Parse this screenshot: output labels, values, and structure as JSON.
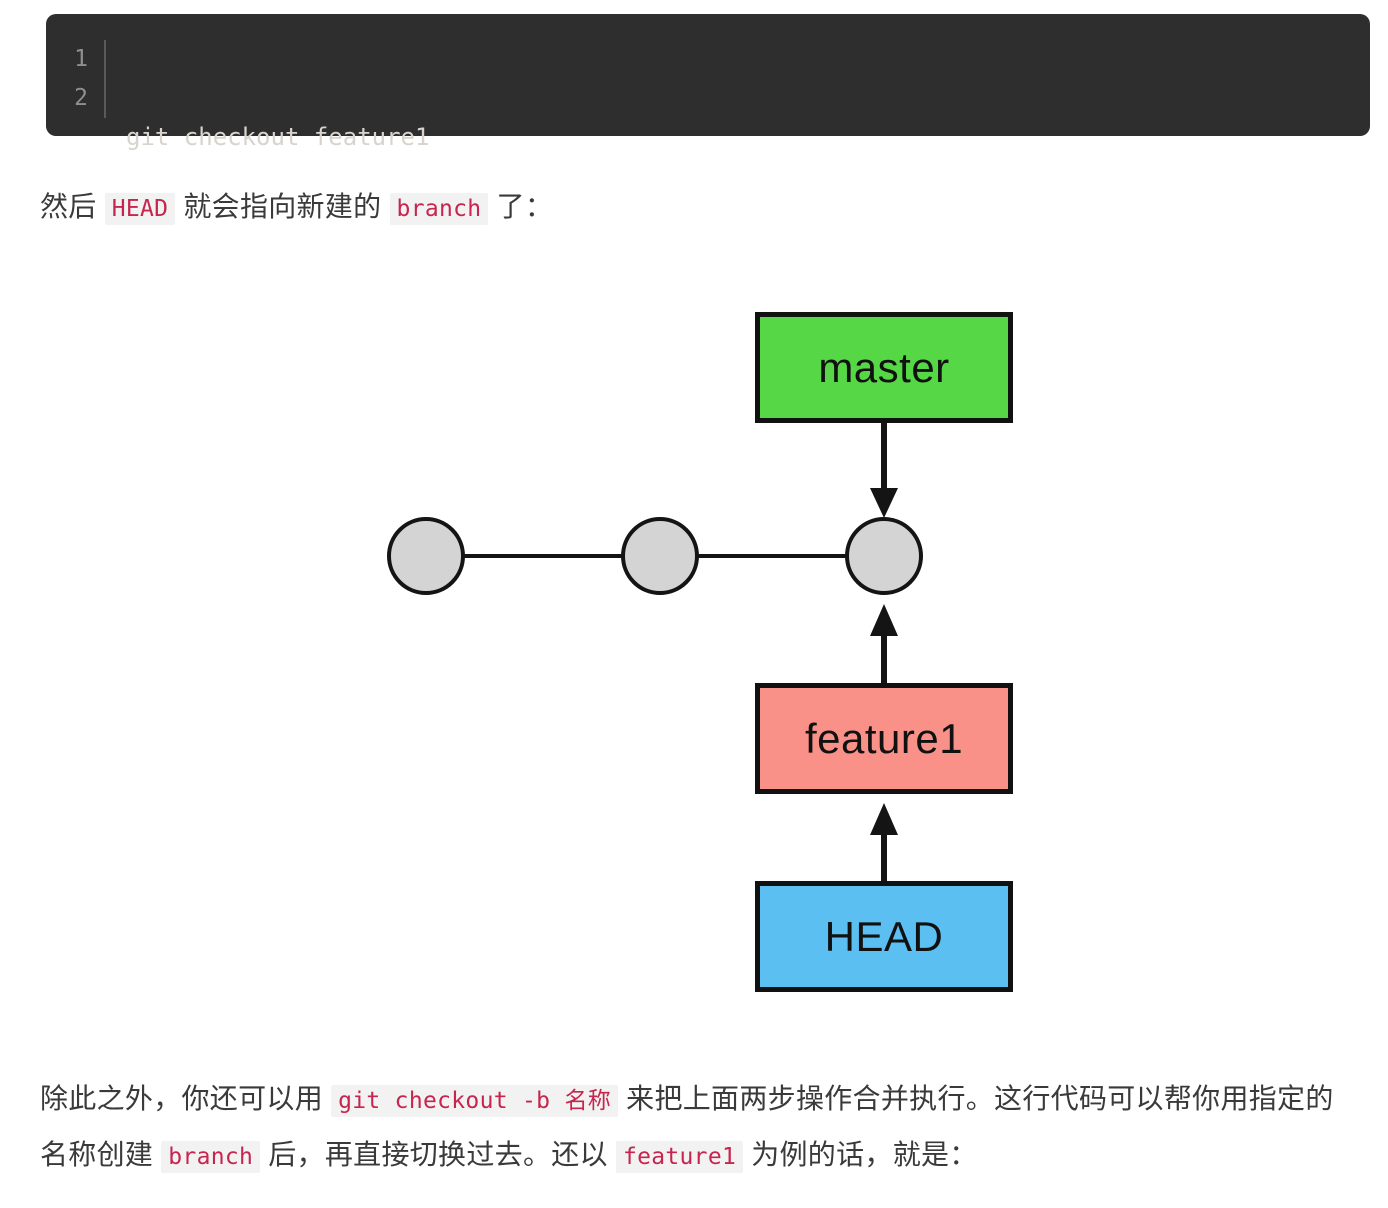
{
  "code_block": {
    "line_numbers": [
      "1",
      "2"
    ],
    "lines": [
      "git checkout feature1",
      ""
    ],
    "language": "shell"
  },
  "paragraph_top": {
    "segment_1": "然后 ",
    "code_1": "HEAD",
    "segment_2": " 就会指向新建的 ",
    "code_2": "branch",
    "segment_3": " 了："
  },
  "paragraph_bottom": {
    "segment_1": "除此之外，你还可以用 ",
    "code_1": "git checkout -b 名称",
    "segment_2": " 来把上面两步操作合并执行。这行代码可以帮你用指定的名称创建 ",
    "code_2": "branch",
    "segment_3": " 后，再直接切换过去。还以 ",
    "code_3": "feature1",
    "segment_4": " 为例的话，就是："
  },
  "diagram": {
    "nodes": [
      {
        "id": "master",
        "label": "master",
        "color": "#56d745"
      },
      {
        "id": "feature1",
        "label": "feature1",
        "color": "#fa9189"
      },
      {
        "id": "head",
        "label": "HEAD",
        "color": "#5bbff2"
      }
    ],
    "commits": [
      {
        "id": "commit-1"
      },
      {
        "id": "commit-2"
      },
      {
        "id": "commit-3"
      }
    ],
    "arrows": [
      {
        "id": "master-to-commit",
        "direction": "down",
        "from": "master",
        "to": "commit-3"
      },
      {
        "id": "feature1-to-commit",
        "direction": "up",
        "from": "feature1",
        "to": "commit-3"
      },
      {
        "id": "head-to-feature1",
        "direction": "up",
        "from": "head",
        "to": "feature1"
      }
    ],
    "commit_color": "#d4d4d4",
    "line_color": "#141414"
  }
}
